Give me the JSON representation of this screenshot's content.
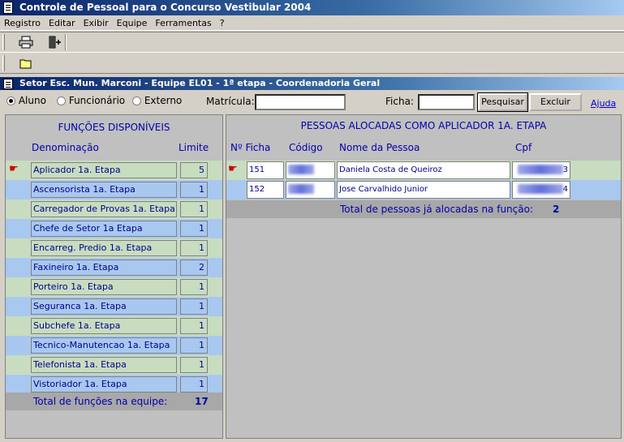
{
  "window": {
    "title": "Controle de Pessoal para o Concurso Vestibular 2004"
  },
  "menu": [
    "Registro",
    "Editar",
    "Exibir",
    "Equipe",
    "Ferramentas",
    "?"
  ],
  "toolbar": {
    "icons": [
      "printer-icon",
      "exit-door-icon",
      "folder-icon"
    ]
  },
  "panel": {
    "header": "Setor Esc. Mun. Marconi - Equipe EL01 - 1ª etapa - Coordenadoria Geral"
  },
  "search": {
    "options": [
      {
        "label": "Aluno",
        "checked": true
      },
      {
        "label": "Funcionário",
        "checked": false
      },
      {
        "label": "Externo",
        "checked": false
      }
    ],
    "matricula_label": "Matrícula:",
    "matricula_value": "",
    "ficha_label": "Ficha:",
    "ficha_value": "",
    "search_button": "Pesquisar",
    "delete_button": "Excluir",
    "help_link": "Ajuda"
  },
  "functions": {
    "title": "FUNÇÕES DISPONÍVEIS",
    "col_name": "Denominação",
    "col_limit": "Limite",
    "rows": [
      {
        "name": "Aplicador 1a. Etapa",
        "limit": "5"
      },
      {
        "name": "Ascensorista 1a. Etapa",
        "limit": "1"
      },
      {
        "name": "Carregador de Provas 1a. Etapa",
        "limit": "1"
      },
      {
        "name": "Chefe de Setor 1a Etapa",
        "limit": "1"
      },
      {
        "name": "Encarreg. Predio 1a. Etapa",
        "limit": "1"
      },
      {
        "name": "Faxineiro 1a. Etapa",
        "limit": "2"
      },
      {
        "name": "Porteiro 1a. Etapa",
        "limit": "1"
      },
      {
        "name": "Seguranca 1a. Etapa",
        "limit": "1"
      },
      {
        "name": "Subchefe 1a. Etapa",
        "limit": "1"
      },
      {
        "name": "Tecnico-Manutencao 1a. Etapa",
        "limit": "1"
      },
      {
        "name": "Telefonista 1a. Etapa",
        "limit": "1"
      },
      {
        "name": "Vistoriador 1a. Etapa",
        "limit": "1"
      }
    ],
    "total_label": "Total de funções na equipe:",
    "total_value": "17"
  },
  "people": {
    "title": "PESSOAS ALOCADAS COMO APLICADOR 1A. ETAPA",
    "col_ficha": "Nº Ficha",
    "col_codigo": "Código",
    "col_nome": "Nome da Pessoa",
    "col_cpf": "Cpf",
    "rows": [
      {
        "ficha": "151",
        "nome": "Daniela Costa de Queiroz",
        "cpf_end": "3"
      },
      {
        "ficha": "152",
        "nome": "Jose Carvalhido Junior",
        "cpf_end": "4"
      }
    ],
    "total_label": "Total de pessoas já alocadas na função:",
    "total_value": "2"
  },
  "colors": {
    "row_green": "#c8dcc0",
    "row_blue": "#a8c8f0",
    "accent": "#0000aa",
    "pointer": "#d00000"
  }
}
